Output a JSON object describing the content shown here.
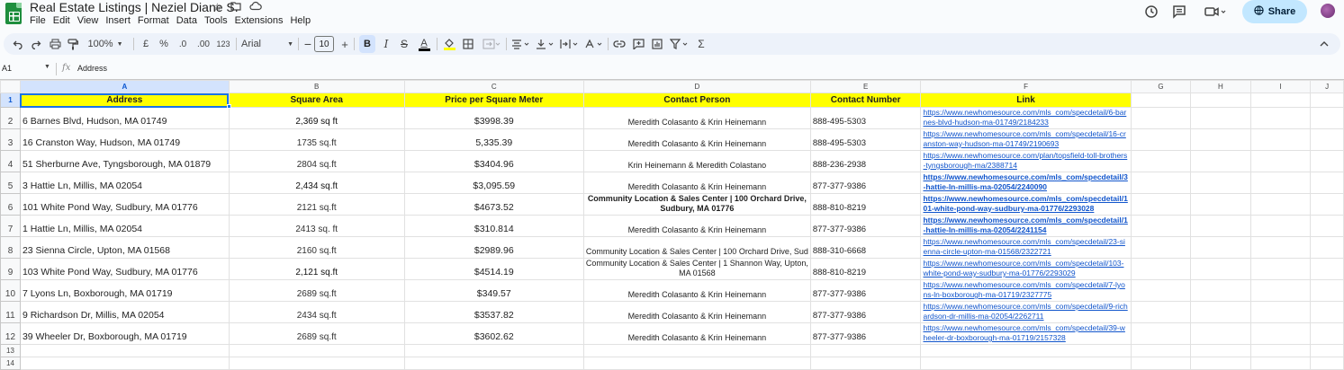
{
  "app": {
    "doc_title": "Real Estate Listings | Neziel Diane S.",
    "menu": [
      "File",
      "Edit",
      "View",
      "Insert",
      "Format",
      "Data",
      "Tools",
      "Extensions",
      "Help"
    ],
    "share_label": "Share"
  },
  "toolbar": {
    "zoom": "100%",
    "currency": "£",
    "percent": "%",
    "dec_decrease": ".0",
    "dec_increase": ".00",
    "number_format": "123",
    "font": "Arial",
    "font_size": "10",
    "bold": "B",
    "italic": "I",
    "strike": "S",
    "text_color": "A",
    "minus": "−",
    "plus": "+",
    "sigma": "Σ"
  },
  "formula_bar": {
    "cell_ref": "A1",
    "fx": "fx",
    "value": "Address"
  },
  "columns": [
    "A",
    "B",
    "C",
    "D",
    "E",
    "F",
    "G",
    "H",
    "I",
    "J"
  ],
  "headers": [
    "Address",
    "Square Area",
    "Price per Square Meter",
    "Contact Person",
    "Contact Number",
    "Link"
  ],
  "rows": [
    {
      "n": "2",
      "address": "6 Barnes Blvd, Hudson, MA 01749",
      "area": "2,369 sq ft",
      "price": "$3998.39",
      "contact": "Meredith Colasanto & Krin Heinemann",
      "phone": "888-495-5303",
      "link": "https://www.newhomesource.com/mls_com/specdetail/6-barnes-blvd-hudson-ma-01749/2184233"
    },
    {
      "n": "3",
      "address": "16 Cranston Way, Hudson, MA 01749",
      "area": "1735 sq.ft",
      "price": "5,335.39",
      "contact": "Meredith Colasanto & Krin Heinemann",
      "phone": "888-495-5303",
      "link": "https://www.newhomesource.com/mls_com/specdetail/16-cranston-way-hudson-ma-01749/2190693"
    },
    {
      "n": "4",
      "address": "51 Sherburne Ave, Tyngsborough, MA 01879",
      "area": "2804 sq.ft",
      "price": "$3404.96",
      "contact": "Krin Heinemann & Meredith Colastano",
      "phone": "888-236-2938",
      "link": "https://www.newhomesource.com/plan/topsfield-toll-brothers-tyngsborough-ma/2388714"
    },
    {
      "n": "5",
      "address": "3 Hattie Ln, Millis, MA 02054",
      "area": "2,434 sq.ft",
      "price": "$3,095.59",
      "contact": "Meredith Colasanto & Krin Heinemann",
      "phone": "877-377-9386",
      "link": "https://www.newhomesource.com/mls_com/specdetail/3-hattie-ln-millis-ma-02054/2240090"
    },
    {
      "n": "6",
      "address": "101 White Pond Way, Sudbury, MA 01776",
      "area": "2121 sq.ft",
      "price": "$4673.52",
      "contact": "Community Location & Sales Center | 100 Orchard Drive, Sudbury, MA 01776",
      "phone": "888-810-8219",
      "link": "https://www.newhomesource.com/mls_com/specdetail/101-white-pond-way-sudbury-ma-01776/2293028"
    },
    {
      "n": "7",
      "address": "1 Hattie Ln, Millis, MA 02054",
      "area": "2413 sq. ft",
      "price": "$310.814",
      "contact": "Meredith Colasanto & Krin Heinemann",
      "phone": "877-377-9386",
      "link": "https://www.newhomesource.com/mls_com/specdetail/1-hattie-ln-millis-ma-02054/2241154"
    },
    {
      "n": "8",
      "address": "23 Sienna Circle, Upton, MA 01568",
      "area": "2160 sq.ft",
      "price": "$2989.96",
      "contact": "Community Location & Sales Center | 100 Orchard Drive, Sud",
      "phone": "888-310-6668",
      "link": "https://www.newhomesource.com/mls_com/specdetail/23-sienna-circle-upton-ma-01568/2322721"
    },
    {
      "n": "9",
      "address": "103 White Pond Way, Sudbury, MA 01776",
      "area": "2,121 sq.ft",
      "price": "$4514.19",
      "contact": "Community Location & Sales Center | 1 Shannon Way, Upton, MA 01568",
      "phone": "888-810-8219",
      "link": "https://www.newhomesource.com/mls_com/specdetail/103-white-pond-way-sudbury-ma-01776/2293029"
    },
    {
      "n": "10",
      "address": "7 Lyons Ln, Boxborough, MA 01719",
      "area": "2689 sq.ft",
      "price": "$349.57",
      "contact": "Meredith Colasanto & Krin Heinemann",
      "phone": "877-377-9386",
      "link": "https://www.newhomesource.com/mls_com/specdetail/7-lyons-ln-boxborough-ma-01719/2327775"
    },
    {
      "n": "11",
      "address": "9 Richardson Dr, Millis, MA 02054",
      "area": "2434 sq.ft",
      "price": "$3537.82",
      "contact": "Meredith Colasanto & Krin Heinemann",
      "phone": "877-377-9386",
      "link": "https://www.newhomesource.com/mls_com/specdetail/9-richardson-dr-millis-ma-02054/2262711"
    },
    {
      "n": "12",
      "address": "39 Wheeler Dr, Boxborough, MA 01719",
      "area": "2689 sq.ft",
      "price": "$3602.62",
      "contact": "Meredith Colasanto & Krin Heinemann",
      "phone": "877-377-9386",
      "link": "https://www.newhomesource.com/mls_com/specdetail/39-wheeler-dr-boxborough-ma-01719/2157328"
    }
  ],
  "row_numbers_extra": [
    "1",
    "13",
    "14"
  ],
  "colors": {
    "header_fill": "#ffff00",
    "link": "#1155cc",
    "share_bg": "#c2e7ff",
    "selection": "#1a73e8"
  }
}
